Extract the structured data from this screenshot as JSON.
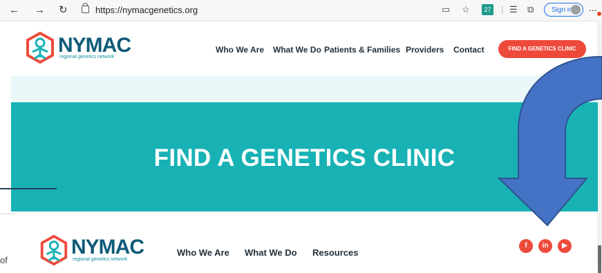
{
  "browser": {
    "url": "https://nymacgenetics.org",
    "back_icon": "back-arrow-icon",
    "forward_icon": "forward-arrow-icon",
    "refresh_icon": "refresh-icon",
    "extension_badge": "27",
    "signin_label": "Sign in",
    "more_label": "..."
  },
  "header": {
    "logo_text": "NYMAC",
    "logo_tagline": "regional genetics network",
    "nav": [
      "Who We Are",
      "What We Do",
      "Patients & Families",
      "Providers",
      "Contact"
    ],
    "cta_label": "FIND A GENETICS CLINIC"
  },
  "hero": {
    "title": "FIND A GENETICS CLINIC"
  },
  "footer": {
    "logo_text": "NYMAC",
    "logo_tagline": "regional genetics network",
    "nav": [
      "Who We Are",
      "What We Do",
      "Resources"
    ],
    "social": [
      "f",
      "in",
      "▶"
    ]
  },
  "side_text": "of",
  "colors": {
    "accent": "#ee4a3c",
    "teal": "#18b2b5",
    "navy": "#0f5a78",
    "arrow": "#4472c4"
  }
}
